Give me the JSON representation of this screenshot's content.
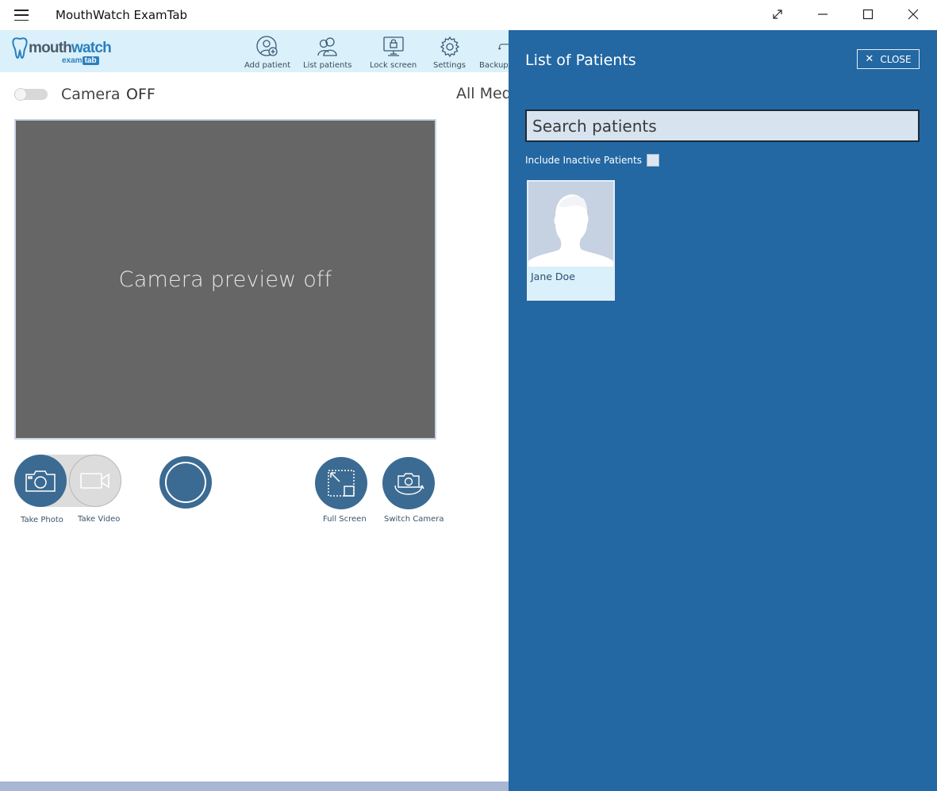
{
  "window": {
    "title": "MouthWatch ExamTab"
  },
  "logo": {
    "brand_prefix": "mouth",
    "brand_suffix": "watch",
    "sub_prefix": "exam",
    "sub_suffix": "tab"
  },
  "toolbar": {
    "items": [
      {
        "label": "Add patient",
        "icon": "add-patient-icon"
      },
      {
        "label": "List patients",
        "icon": "list-patients-icon"
      },
      {
        "label": "Lock screen",
        "icon": "lock-screen-icon"
      },
      {
        "label": "Settings",
        "icon": "gear-icon"
      },
      {
        "label": "Backup/R",
        "icon": "backup-icon"
      }
    ]
  },
  "camera": {
    "label": "Camera",
    "state": "OFF",
    "preview_text": "Camera preview off",
    "all_media_label": "All Med"
  },
  "controls": {
    "take_photo": "Take Photo",
    "take_video": "Take Video",
    "full_screen": "Full Screen",
    "switch_camera": "Switch Camera"
  },
  "panel": {
    "title": "List of Patients",
    "close_label": "CLOSE",
    "search_placeholder": "Search patients",
    "include_inactive_label": "Include Inactive Patients",
    "include_inactive_checked": false,
    "patients": [
      {
        "name": "Jane Doe"
      }
    ]
  },
  "colors": {
    "panel_bg": "#2367a3",
    "toolbar_bg": "#daf0fa",
    "button_dark": "#3b6b92",
    "preview_bg": "#666666"
  }
}
